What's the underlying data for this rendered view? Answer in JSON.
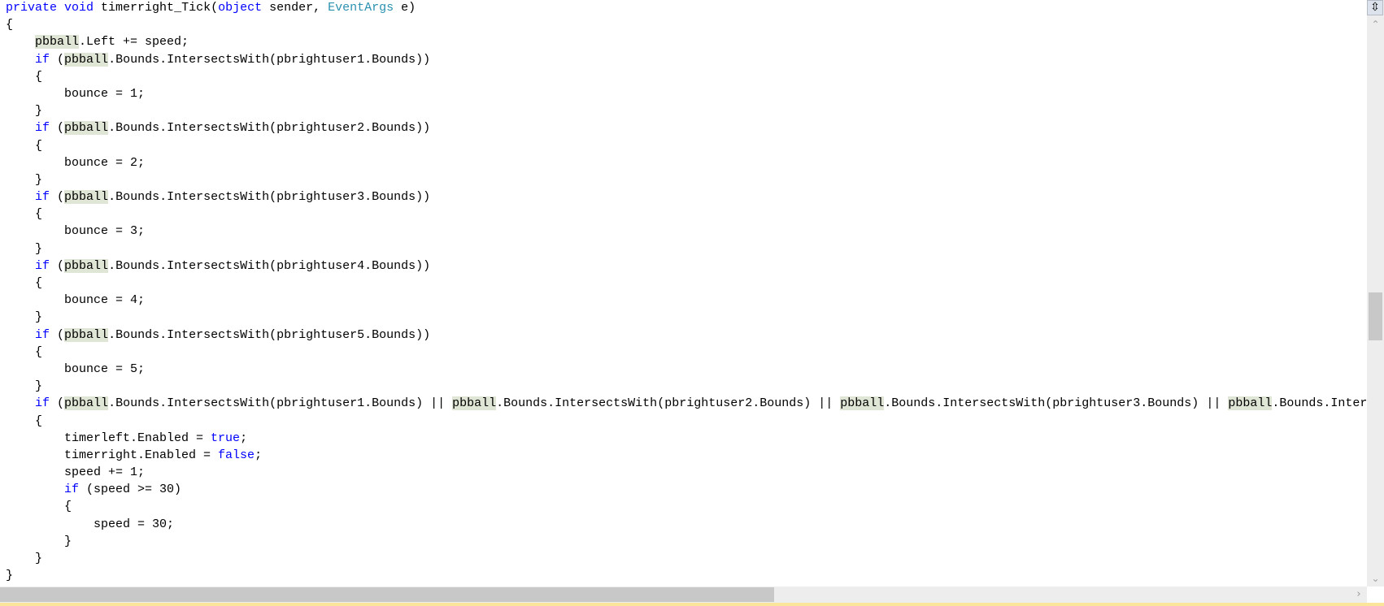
{
  "editor": {
    "lines": [
      [
        {
          "t": "private",
          "c": "kw"
        },
        {
          "t": " "
        },
        {
          "t": "void",
          "c": "kw"
        },
        {
          "t": " timerright_Tick("
        },
        {
          "t": "object",
          "c": "kw"
        },
        {
          "t": " sender, "
        },
        {
          "t": "EventArgs",
          "c": "type"
        },
        {
          "t": " e)"
        }
      ],
      [
        {
          "t": "{"
        }
      ],
      [
        {
          "t": "    "
        },
        {
          "t": "pbball",
          "c": "hl"
        },
        {
          "t": ".Left += speed;"
        }
      ],
      [
        {
          "t": "    "
        },
        {
          "t": "if",
          "c": "kw"
        },
        {
          "t": " ("
        },
        {
          "t": "pbball",
          "c": "hl"
        },
        {
          "t": ".Bounds.IntersectsWith(pbrightuser1.Bounds))"
        }
      ],
      [
        {
          "t": "    {"
        }
      ],
      [
        {
          "t": "        bounce = 1;"
        }
      ],
      [
        {
          "t": "    }"
        }
      ],
      [
        {
          "t": "    "
        },
        {
          "t": "if",
          "c": "kw"
        },
        {
          "t": " ("
        },
        {
          "t": "pbball",
          "c": "hl"
        },
        {
          "t": ".Bounds.IntersectsWith(pbrightuser2.Bounds))"
        }
      ],
      [
        {
          "t": "    {"
        }
      ],
      [
        {
          "t": "        bounce = 2;"
        }
      ],
      [
        {
          "t": "    }"
        }
      ],
      [
        {
          "t": "    "
        },
        {
          "t": "if",
          "c": "kw"
        },
        {
          "t": " ("
        },
        {
          "t": "pbball",
          "c": "hl"
        },
        {
          "t": ".Bounds.IntersectsWith(pbrightuser3.Bounds))"
        }
      ],
      [
        {
          "t": "    {"
        }
      ],
      [
        {
          "t": "        bounce = 3;"
        }
      ],
      [
        {
          "t": "    }"
        }
      ],
      [
        {
          "t": "    "
        },
        {
          "t": "if",
          "c": "kw"
        },
        {
          "t": " ("
        },
        {
          "t": "pbball",
          "c": "hl"
        },
        {
          "t": ".Bounds.IntersectsWith(pbrightuser4.Bounds))"
        }
      ],
      [
        {
          "t": "    {"
        }
      ],
      [
        {
          "t": "        bounce = 4;"
        }
      ],
      [
        {
          "t": "    }"
        }
      ],
      [
        {
          "t": "    "
        },
        {
          "t": "if",
          "c": "kw"
        },
        {
          "t": " ("
        },
        {
          "t": "pbball",
          "c": "hl"
        },
        {
          "t": ".Bounds.IntersectsWith(pbrightuser5.Bounds))"
        }
      ],
      [
        {
          "t": "    {"
        }
      ],
      [
        {
          "t": "        bounce = 5;"
        }
      ],
      [
        {
          "t": "    }"
        }
      ],
      [
        {
          "t": "    "
        },
        {
          "t": "if",
          "c": "kw"
        },
        {
          "t": " ("
        },
        {
          "t": "pbball",
          "c": "hl"
        },
        {
          "t": ".Bounds.IntersectsWith(pbrightuser1.Bounds) || "
        },
        {
          "t": "pbball",
          "c": "hl"
        },
        {
          "t": ".Bounds.IntersectsWith(pbrightuser2.Bounds) || "
        },
        {
          "t": "pbball",
          "c": "hl"
        },
        {
          "t": ".Bounds.IntersectsWith(pbrightuser3.Bounds) || "
        },
        {
          "t": "pbball",
          "c": "hl"
        },
        {
          "t": ".Bounds.Inter"
        }
      ],
      [
        {
          "t": "    {"
        }
      ],
      [
        {
          "t": "        timerleft.Enabled = "
        },
        {
          "t": "true",
          "c": "kw"
        },
        {
          "t": ";"
        }
      ],
      [
        {
          "t": "        timerright.Enabled = "
        },
        {
          "t": "false",
          "c": "kw"
        },
        {
          "t": ";"
        }
      ],
      [
        {
          "t": "        speed += 1;"
        }
      ],
      [
        {
          "t": "        "
        },
        {
          "t": "if",
          "c": "kw"
        },
        {
          "t": " (speed >= 30)"
        }
      ],
      [
        {
          "t": "        {"
        }
      ],
      [
        {
          "t": "            speed = 30;"
        }
      ],
      [
        {
          "t": "        }"
        }
      ],
      [
        {
          "t": "    }"
        }
      ],
      [
        {
          "t": "}"
        }
      ]
    ]
  },
  "scrollbars": {
    "split_icon": "⇳",
    "up_icon": "⌃",
    "down_icon": "⌄",
    "right_icon": "›",
    "vertical_position": 0.5,
    "horizontal_position": 0.0
  }
}
